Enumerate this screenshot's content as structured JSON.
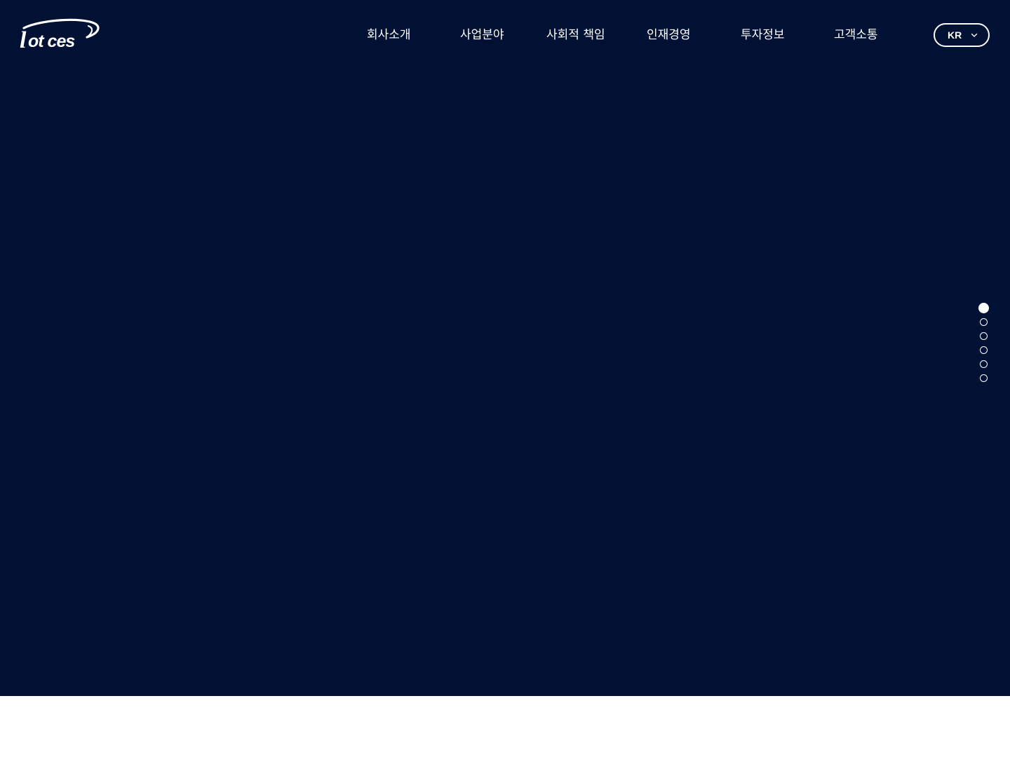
{
  "header": {
    "logo_text": "lotces",
    "nav": [
      {
        "label": "회사소개"
      },
      {
        "label": "사업분야"
      },
      {
        "label": "사회적 책임"
      },
      {
        "label": "인재경영"
      },
      {
        "label": "투자정보"
      },
      {
        "label": "고객소통"
      }
    ],
    "language": {
      "selected": "KR",
      "icon": "chevron-down-icon"
    }
  },
  "hero": {
    "background_color": "#001133"
  },
  "pager": {
    "total": 6,
    "active_index": 0
  },
  "colors": {
    "primary_navy": "#001133",
    "text": "#ffffff",
    "page_background": "#ffffff"
  }
}
